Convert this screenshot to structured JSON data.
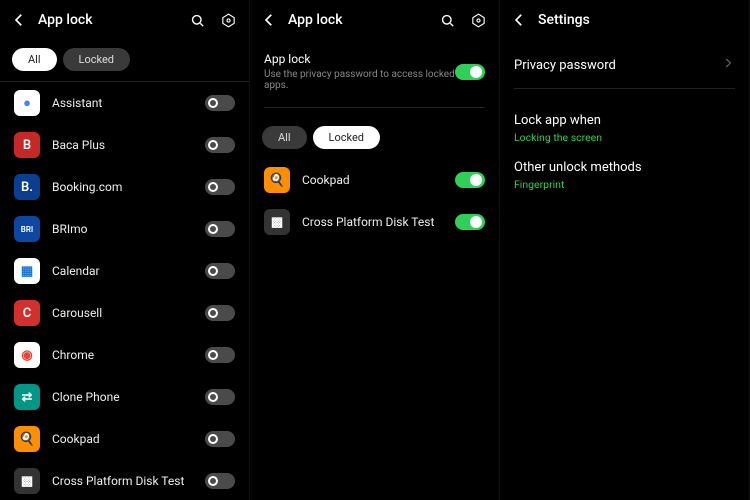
{
  "panel1": {
    "title": "App lock",
    "tabs": {
      "all": "All",
      "locked": "Locked",
      "active": "all"
    },
    "apps": [
      {
        "name": "Assistant",
        "iconBg": "#ffffff",
        "iconFg": "#4285f4",
        "glyph": "●"
      },
      {
        "name": "Baca Plus",
        "iconBg": "#c62828",
        "iconFg": "#fff",
        "glyph": "B"
      },
      {
        "name": "Booking.com",
        "iconBg": "#0b3d91",
        "iconFg": "#fff",
        "glyph": "B."
      },
      {
        "name": "BRImo",
        "iconBg": "#0d47a1",
        "iconFg": "#fff",
        "glyph": "BRI"
      },
      {
        "name": "Calendar",
        "iconBg": "#ffffff",
        "iconFg": "#1976d2",
        "glyph": "▦"
      },
      {
        "name": "Carousell",
        "iconBg": "#d32f2f",
        "iconFg": "#fff",
        "glyph": "C"
      },
      {
        "name": "Chrome",
        "iconBg": "#ffffff",
        "iconFg": "#ea4335",
        "glyph": "◉"
      },
      {
        "name": "Clone Phone",
        "iconBg": "#009688",
        "iconFg": "#fff",
        "glyph": "⇄"
      },
      {
        "name": "Cookpad",
        "iconBg": "#ff8f00",
        "iconFg": "#fff",
        "glyph": "🍳"
      },
      {
        "name": "Cross Platform Disk Test",
        "iconBg": "#333",
        "iconFg": "#fff",
        "glyph": "▩"
      }
    ]
  },
  "panel2": {
    "title": "App lock",
    "masterLabel": "App lock",
    "masterSub": "Use the privacy password to access locked apps.",
    "masterOn": true,
    "tabs": {
      "all": "All",
      "locked": "Locked",
      "active": "locked"
    },
    "apps": [
      {
        "name": "Cookpad",
        "iconBg": "#ff8f00",
        "iconFg": "#fff",
        "glyph": "🍳",
        "on": true
      },
      {
        "name": "Cross Platform Disk Test",
        "iconBg": "#333",
        "iconFg": "#fff",
        "glyph": "▩",
        "on": true
      }
    ]
  },
  "panel3": {
    "title": "Settings",
    "privacyPassword": "Privacy password",
    "lockWhen": {
      "label": "Lock app when",
      "value": "Locking the screen"
    },
    "otherUnlock": {
      "label": "Other unlock methods",
      "value": "Fingerprint"
    }
  }
}
